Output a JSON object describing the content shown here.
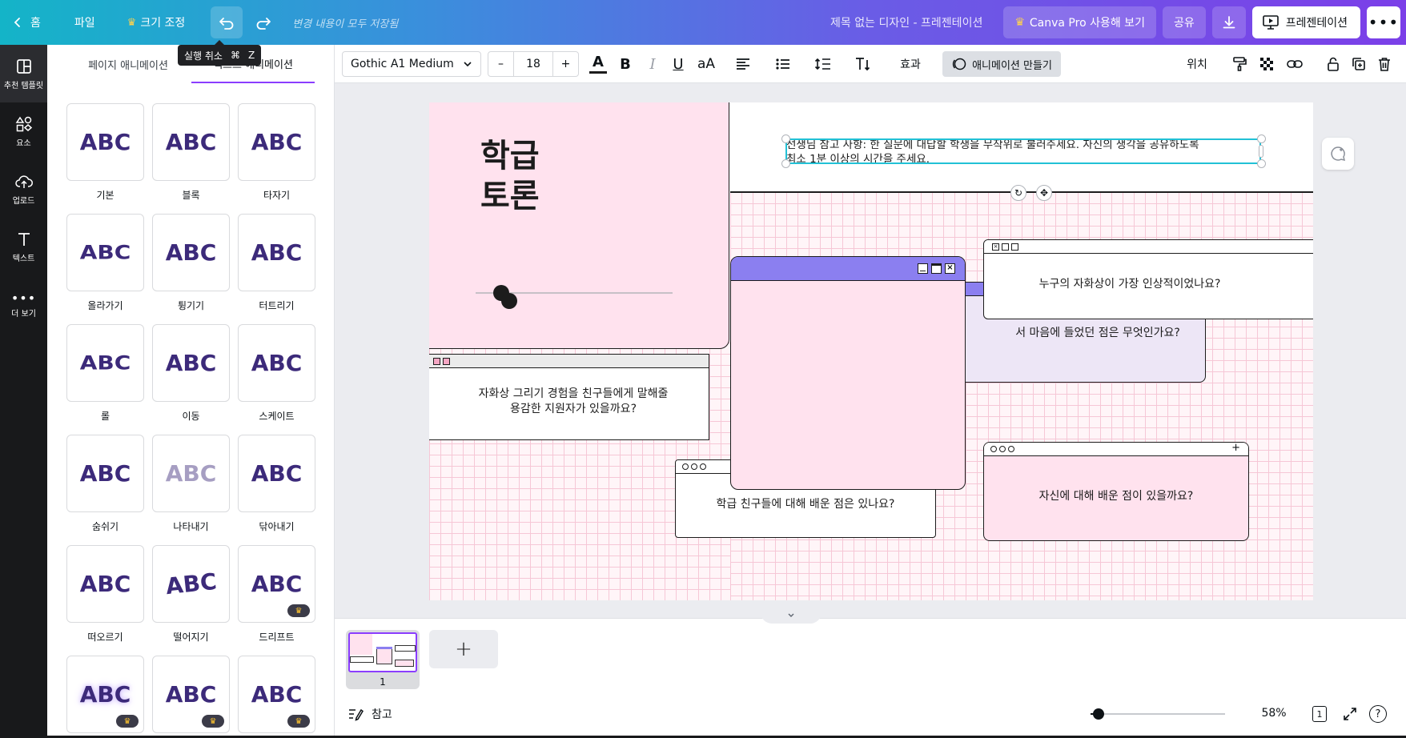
{
  "topbar": {
    "home_label": "홈",
    "file_label": "파일",
    "resize_label": "크기 조정",
    "saved_status": "변경 내용이 모두 저장됨",
    "doc_title": "제목 없는 디자인 - 프레젠테이션",
    "pro_label": "Canva Pro 사용해 보기",
    "share_label": "공유",
    "present_label": "프레젠테이션",
    "tooltip_text": "실행 취소",
    "tooltip_key1": "⌘",
    "tooltip_key2": "Z"
  },
  "sidebar": {
    "items": [
      {
        "label": "추천 템플릿",
        "icon": "layout-icon"
      },
      {
        "label": "요소",
        "icon": "shapes-icon"
      },
      {
        "label": "업로드",
        "icon": "cloud-upload-icon"
      },
      {
        "label": "텍스트",
        "icon": "text-icon"
      },
      {
        "label": "더 보기",
        "icon": "more-icon"
      }
    ]
  },
  "panel": {
    "tab_page": "페이지 애니메이션",
    "tab_text": "텍스트 애니메이션",
    "tile_text": "ABC",
    "tiles": [
      {
        "label": "기본"
      },
      {
        "label": "블록"
      },
      {
        "label": "타자기"
      },
      {
        "label": "올라가기"
      },
      {
        "label": "튕기기"
      },
      {
        "label": "터트리기"
      },
      {
        "label": "롤"
      },
      {
        "label": "이동"
      },
      {
        "label": "스케이트"
      },
      {
        "label": "숨쉬기"
      },
      {
        "label": "나타내기"
      },
      {
        "label": "닦아내기"
      },
      {
        "label": "떠오르기"
      },
      {
        "label": "떨어지기"
      },
      {
        "label": "드리프트"
      },
      {
        "label": ""
      },
      {
        "label": ""
      },
      {
        "label": ""
      }
    ],
    "crown_glyph": "♛"
  },
  "toolbar": {
    "font_name": "Gothic A1 Medium",
    "font_size": "18",
    "minus": "–",
    "plus": "+",
    "bold": "B",
    "italic": "I",
    "underline": "U",
    "case": "aA",
    "effects": "효과",
    "animate": "애니메이션 만들기",
    "position": "위치"
  },
  "slide": {
    "title_line1": "학급",
    "title_line2": "토론",
    "teacher_note_line1": "선생님 참고 사항: 한 질문에 대답할 학생을 무작위로 불러주세요. 자신의 생각을 공유하도록",
    "teacher_note_line2": "최소 1분 이상의 시간을 주세요.",
    "q1": "누구의 자화상이 가장 인상적이었나요?",
    "q2": "서 마음에 들었던 점은 무엇인가요?",
    "q3_line1": "자화상 그리기 경험을 친구들에게 말해줄",
    "q3_line2": "용감한 지원자가 있을까요?",
    "q4": "자신에 대해 배운 점이 있을까요?",
    "q5": "학급 친구들에 대해 배운 점은 있나요?"
  },
  "footer": {
    "page_number": "1",
    "add_page": "+",
    "notes_label": "참고",
    "zoom_level": "58%",
    "page_count": "1",
    "help": "?",
    "zoom_value": 0.06
  },
  "colors": {
    "accent_purple": "#8b7ff0",
    "pink_panel": "#ffe2ee",
    "lavender": "#ede6f6",
    "selection": "#22c1d6"
  }
}
